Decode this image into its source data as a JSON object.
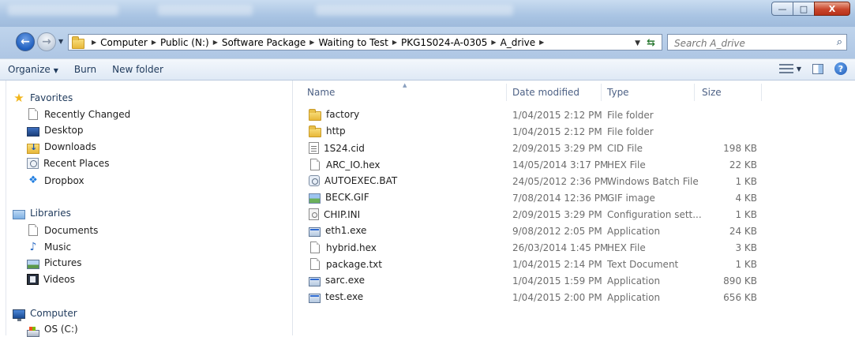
{
  "window": {
    "controls": {
      "minimize": "—",
      "maximize": "□",
      "close": "X"
    }
  },
  "nav": {
    "back_glyph": "←",
    "forward_glyph": "→",
    "breadcrumb": [
      "Computer",
      "Public (N:)",
      "Software Package",
      "Waiting to Test",
      "PKG1S024-A-0305",
      "A_drive"
    ],
    "search_placeholder": "Search A_drive"
  },
  "toolbar": {
    "organize": "Organize",
    "burn": "Burn",
    "new_folder": "New folder"
  },
  "sidebar": {
    "favorites": {
      "label": "Favorites",
      "items": [
        {
          "label": "Recently Changed",
          "icon": "page-icon"
        },
        {
          "label": "Desktop",
          "icon": "desktop-icon"
        },
        {
          "label": "Downloads",
          "icon": "downloads-icon"
        },
        {
          "label": "Recent Places",
          "icon": "recent-places-icon"
        },
        {
          "label": "Dropbox",
          "icon": "dropbox-icon"
        }
      ]
    },
    "libraries": {
      "label": "Libraries",
      "items": [
        {
          "label": "Documents",
          "icon": "documents-icon"
        },
        {
          "label": "Music",
          "icon": "music-icon"
        },
        {
          "label": "Pictures",
          "icon": "pictures-icon"
        },
        {
          "label": "Videos",
          "icon": "videos-icon"
        }
      ]
    },
    "computer": {
      "label": "Computer",
      "items": [
        {
          "label": "OS (C:)",
          "icon": "drive-icon"
        }
      ]
    }
  },
  "files": {
    "columns": {
      "name": "Name",
      "date": "Date modified",
      "type": "Type",
      "size": "Size"
    },
    "rows": [
      {
        "name": "factory",
        "date": "1/04/2015 2:12 PM",
        "type": "File folder",
        "size": "",
        "icon": "folder"
      },
      {
        "name": "http",
        "date": "1/04/2015 2:12 PM",
        "type": "File folder",
        "size": "",
        "icon": "folder"
      },
      {
        "name": "1S24.cid",
        "date": "2/09/2015 3:29 PM",
        "type": "CID File",
        "size": "198 KB",
        "icon": "cid"
      },
      {
        "name": "ARC_IO.hex",
        "date": "14/05/2014 3:17 PM",
        "type": "HEX File",
        "size": "22 KB",
        "icon": "doc"
      },
      {
        "name": "AUTOEXEC.BAT",
        "date": "24/05/2012 2:36 PM",
        "type": "Windows Batch File",
        "size": "1 KB",
        "icon": "gear"
      },
      {
        "name": "BECK.GIF",
        "date": "7/08/2014 12:36 PM",
        "type": "GIF image",
        "size": "4 KB",
        "icon": "img"
      },
      {
        "name": "CHIP.INI",
        "date": "2/09/2015 3:29 PM",
        "type": "Configuration sett...",
        "size": "1 KB",
        "icon": "ini"
      },
      {
        "name": "eth1.exe",
        "date": "9/08/2012 2:05 PM",
        "type": "Application",
        "size": "24 KB",
        "icon": "app"
      },
      {
        "name": "hybrid.hex",
        "date": "26/03/2014 1:45 PM",
        "type": "HEX File",
        "size": "3 KB",
        "icon": "doc"
      },
      {
        "name": "package.txt",
        "date": "1/04/2015 2:14 PM",
        "type": "Text Document",
        "size": "1 KB",
        "icon": "doc"
      },
      {
        "name": "sarc.exe",
        "date": "1/04/2015 1:59 PM",
        "type": "Application",
        "size": "890 KB",
        "icon": "app"
      },
      {
        "name": "test.exe",
        "date": "1/04/2015 2:00 PM",
        "type": "Application",
        "size": "656 KB",
        "icon": "app"
      }
    ]
  },
  "colors": {
    "titlebar": "#a9c4e3",
    "close_button": "#c9462c",
    "header_text": "#4d6185",
    "secondary_text": "#6d6d6d"
  }
}
